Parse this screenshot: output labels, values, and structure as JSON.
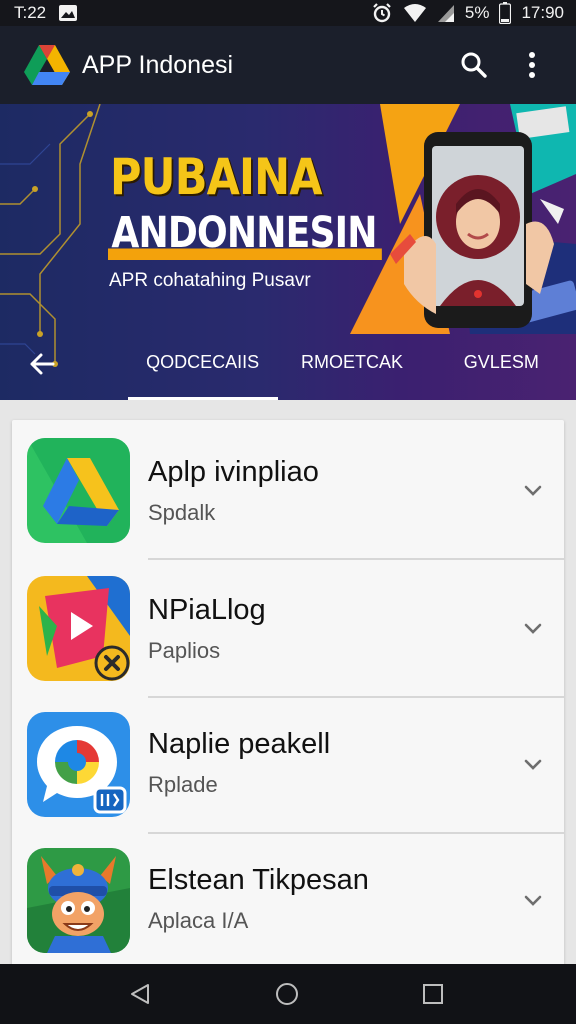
{
  "status_bar": {
    "time_left": "T:22",
    "battery": "5%",
    "time_right": "17:90",
    "icons": [
      "gallery-icon",
      "alarm-icon",
      "wifi-icon",
      "signal-icon",
      "battery-icon"
    ]
  },
  "app_bar": {
    "title": "APP Indonesi",
    "icons": [
      "app-logo-icon",
      "search-icon",
      "more-vert-icon"
    ]
  },
  "banner": {
    "headline": "PUBAINA",
    "subhead": "ANDONNESIN",
    "tagline": "APR cohatahing Pusavr",
    "tabs": [
      {
        "label": "QODCECAIIS"
      },
      {
        "label": "RMOETCAK"
      },
      {
        "label": "GVLESM"
      }
    ],
    "active_tab_index": 0,
    "colors": {
      "headline": "#f5c518",
      "underline": "#f3a20c"
    }
  },
  "list": {
    "items": [
      {
        "title": "Aplp ivinpliao",
        "subtitle": "Spdalk",
        "icon": "triangle-drive-app-icon"
      },
      {
        "title": "NPiaLlog",
        "subtitle": "Paplios",
        "icon": "play-media-app-icon"
      },
      {
        "title": "Naplie peakell",
        "subtitle": "Rplade",
        "icon": "chat-bubble-app-icon"
      },
      {
        "title": "Elstean Tikpesan",
        "subtitle": "Aplaca I/A",
        "icon": "mascot-game-app-icon"
      }
    ]
  },
  "nav_bar": {
    "icons": [
      "back-triangle-icon",
      "home-circle-icon",
      "recents-square-icon"
    ]
  }
}
